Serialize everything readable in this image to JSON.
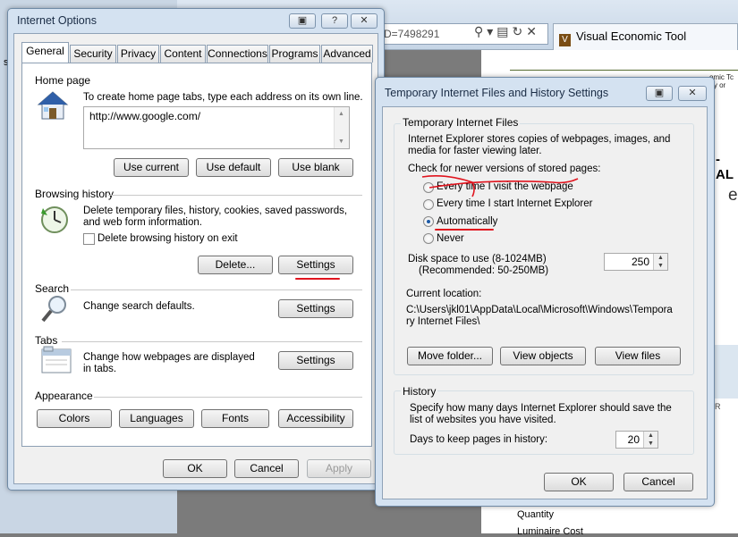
{
  "browser": {
    "address": "D=7498291",
    "tab_title": "Visual Economic Tool",
    "page_fragment_1": "omic Tc",
    "page_fragment_1b": "rty or",
    "page_fragment_2": "- AL",
    "page_fragment_3": "ent",
    "page_fragment_4": "YR",
    "page_label_quantity": "Quantity",
    "page_label_luminaire": "Luminaire Cost",
    "left_letter": "s"
  },
  "internet_options": {
    "title": "Internet Options",
    "title_buttons": [
      "▣",
      "?",
      "✕"
    ],
    "tabs": [
      "General",
      "Security",
      "Privacy",
      "Content",
      "Connections",
      "Programs",
      "Advanced"
    ],
    "home_page": {
      "heading": "Home page",
      "description": "To create home page tabs, type each address on its own line.",
      "url": "http://www.google.com/",
      "use_current": "Use current",
      "use_default": "Use default",
      "use_blank": "Use blank"
    },
    "browsing_history": {
      "heading": "Browsing history",
      "description": "Delete temporary files, history, cookies, saved passwords, and web form information.",
      "delete_on_exit": "Delete browsing history on exit",
      "delete_on_exit_checked": false,
      "delete_button": "Delete...",
      "settings_button": "Settings"
    },
    "search": {
      "heading": "Search",
      "description": "Change search defaults.",
      "settings_button": "Settings"
    },
    "tabs_section": {
      "heading": "Tabs",
      "description": "Change how webpages are displayed in tabs.",
      "settings_button": "Settings"
    },
    "appearance": {
      "heading": "Appearance",
      "colors": "Colors",
      "languages": "Languages",
      "fonts": "Fonts",
      "accessibility": "Accessibility"
    },
    "ok": "OK",
    "cancel": "Cancel",
    "apply": "Apply"
  },
  "temp_files_dialog": {
    "title": "Temporary Internet Files and History Settings",
    "title_buttons": [
      "▣",
      "✕"
    ],
    "temp_group": {
      "heading": "Temporary Internet Files",
      "description": "Internet Explorer stores copies of webpages, images, and media for faster viewing later.",
      "check_label": "Check for newer versions of stored pages:",
      "options": [
        "Every time I visit the webpage",
        "Every time I start Internet Explorer",
        "Automatically",
        "Never"
      ],
      "selected": "Automatically",
      "disk_space_label": "Disk space to use (8-1024MB)",
      "disk_space_recommended": "(Recommended: 50-250MB)",
      "disk_space_value": "250",
      "current_location_label": "Current location:",
      "current_location_path": "C:\\Users\\jkl01\\AppData\\Local\\Microsoft\\Windows\\Temporary Internet Files\\",
      "move_folder": "Move folder...",
      "view_objects": "View objects",
      "view_files": "View files"
    },
    "history_group": {
      "heading": "History",
      "description": "Specify how many days Internet Explorer should save the list of websites you have visited.",
      "days_label": "Days to keep pages in history:",
      "days_value": "20"
    },
    "ok": "OK",
    "cancel": "Cancel"
  },
  "colors": {
    "annotation_red": "#e0141e",
    "dialog_frame": "#d4e2f1",
    "client_bg": "#f0f0f0"
  }
}
